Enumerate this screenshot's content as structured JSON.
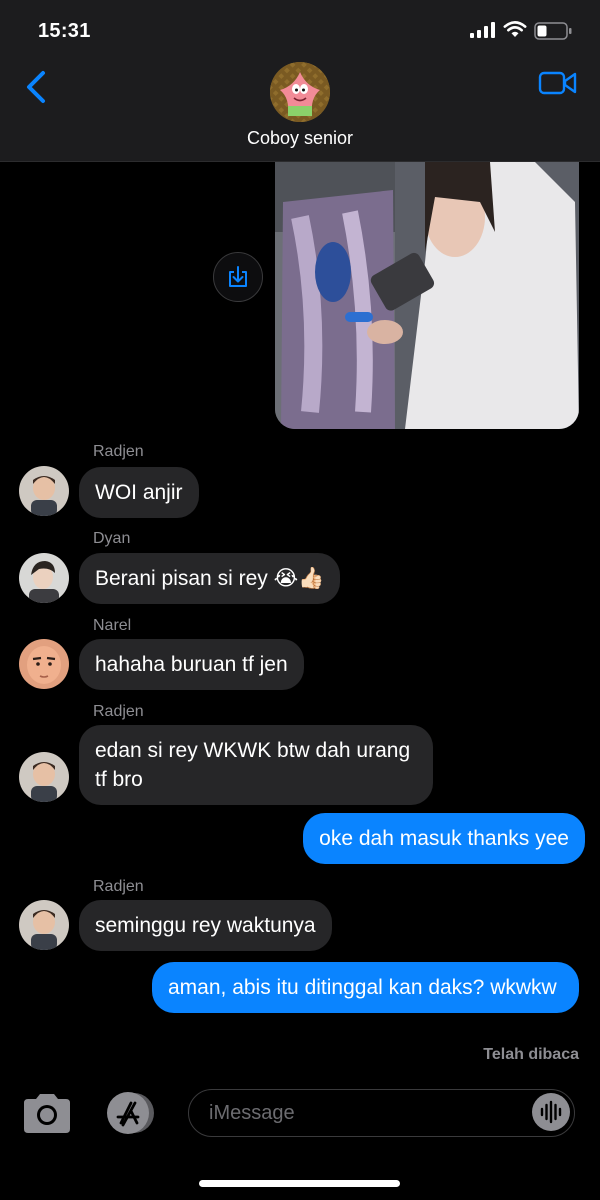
{
  "status_bar": {
    "time": "15:31"
  },
  "header": {
    "contact_name": "Coboy senior"
  },
  "messages": {
    "m1": {
      "sender": "Radjen",
      "text": "WOI anjir"
    },
    "m2": {
      "sender": "Dyan",
      "text": "Berani pisan si rey 😭👍🏻"
    },
    "m3": {
      "sender": "Narel",
      "text": "hahaha buruan tf jen"
    },
    "m4": {
      "sender": "Radjen",
      "text": "edan si rey WKWK btw dah urang tf bro"
    },
    "m5": {
      "text": "oke dah masuk thanks yee"
    },
    "m6": {
      "sender": "Radjen",
      "text": "seminggu rey waktunya"
    },
    "m7": {
      "text": "aman, abis itu ditinggal kan daks? wkwkw"
    }
  },
  "read_receipt": "Telah dibaca",
  "input": {
    "placeholder": "iMessage"
  },
  "colors": {
    "outgoing_bubble": "#0a84ff",
    "incoming_bubble": "#262628",
    "accent": "#0a84ff"
  },
  "icons": [
    "signal-icon",
    "wifi-icon",
    "battery-icon",
    "back-chevron-icon",
    "video-call-icon",
    "download-icon",
    "camera-icon",
    "app-store-icon",
    "voice-memo-icon"
  ]
}
